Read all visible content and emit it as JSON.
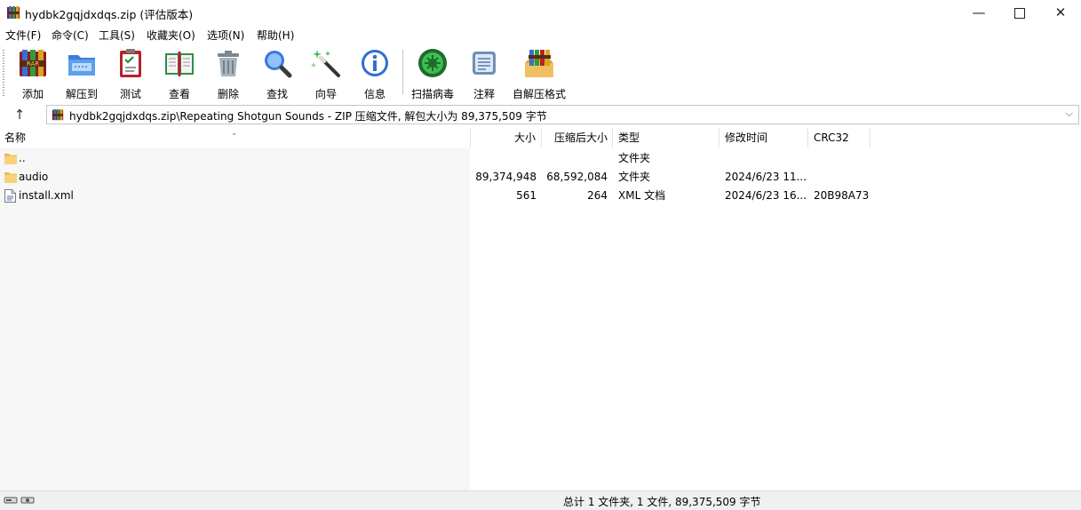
{
  "window": {
    "title": "hydbk2gqjdxdqs.zip (评估版本)",
    "minimize_glyph": "—",
    "close_glyph": "✕"
  },
  "menu": [
    "文件(F)",
    "命令(C)",
    "工具(S)",
    "收藏夹(O)",
    "选项(N)",
    "帮助(H)"
  ],
  "toolbar": {
    "add": "添加",
    "extract": "解压到",
    "test": "测试",
    "view": "查看",
    "delete": "删除",
    "find": "查找",
    "wizard": "向导",
    "info": "信息",
    "scan": "扫描病毒",
    "comment": "注释",
    "sfx": "自解压格式"
  },
  "address": {
    "up_glyph": "↑",
    "path": "hydbk2gqjdxdqs.zip\\Repeating Shotgun Sounds - ZIP 压缩文件, 解包大小为 89,375,509 字节",
    "dropdown_glyph": "⌵"
  },
  "columns": {
    "name": "名称",
    "size": "大小",
    "packed": "压缩后大小",
    "type": "类型",
    "modified": "修改时间",
    "crc": "CRC32",
    "sort_glyph": "⌄"
  },
  "rows": [
    {
      "name": "..",
      "size": "",
      "packed": "",
      "type": "文件夹",
      "modified": "",
      "crc": ""
    },
    {
      "name": "audio",
      "size": "89,374,948",
      "packed": "68,592,084",
      "type": "文件夹",
      "modified": "2024/6/23 11...",
      "crc": ""
    },
    {
      "name": "install.xml",
      "size": "561",
      "packed": "264",
      "type": "XML 文档",
      "modified": "2024/6/23 16...",
      "crc": "20B98A73"
    }
  ],
  "status": {
    "summary": "总计 1 文件夹, 1 文件, 89,375,509 字节"
  }
}
